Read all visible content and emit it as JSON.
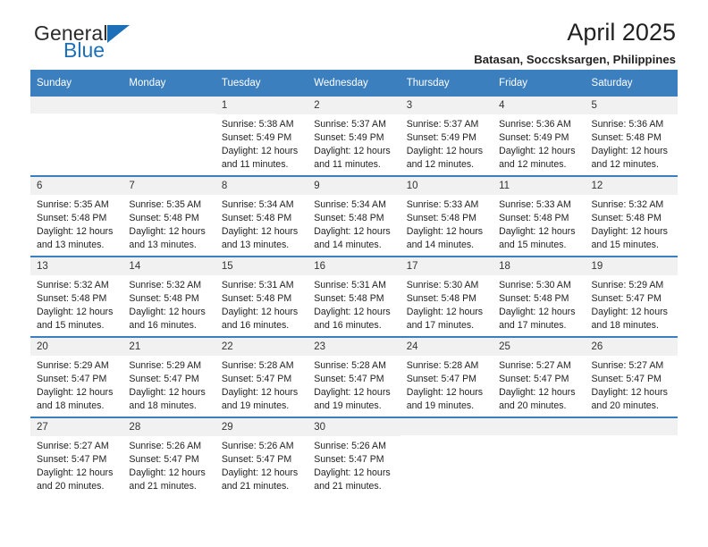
{
  "brand": {
    "name_part1": "General",
    "name_part2": "Blue",
    "accent_color": "#1d70b8"
  },
  "header": {
    "title": "April 2025",
    "subtitle": "Batasan, Soccsksargen, Philippines"
  },
  "calendar": {
    "header_bg": "#3b7fbf",
    "daynum_bg": "#f1f1f1",
    "weekday_headers": [
      "Sunday",
      "Monday",
      "Tuesday",
      "Wednesday",
      "Thursday",
      "Friday",
      "Saturday"
    ],
    "weeks": [
      [
        {
          "day": "",
          "empty": true,
          "sunrise": "",
          "sunset": "",
          "daylight1": "",
          "daylight2": ""
        },
        {
          "day": "",
          "empty": true,
          "sunrise": "",
          "sunset": "",
          "daylight1": "",
          "daylight2": ""
        },
        {
          "day": "1",
          "sunrise": "Sunrise: 5:38 AM",
          "sunset": "Sunset: 5:49 PM",
          "daylight1": "Daylight: 12 hours",
          "daylight2": "and 11 minutes."
        },
        {
          "day": "2",
          "sunrise": "Sunrise: 5:37 AM",
          "sunset": "Sunset: 5:49 PM",
          "daylight1": "Daylight: 12 hours",
          "daylight2": "and 11 minutes."
        },
        {
          "day": "3",
          "sunrise": "Sunrise: 5:37 AM",
          "sunset": "Sunset: 5:49 PM",
          "daylight1": "Daylight: 12 hours",
          "daylight2": "and 12 minutes."
        },
        {
          "day": "4",
          "sunrise": "Sunrise: 5:36 AM",
          "sunset": "Sunset: 5:49 PM",
          "daylight1": "Daylight: 12 hours",
          "daylight2": "and 12 minutes."
        },
        {
          "day": "5",
          "sunrise": "Sunrise: 5:36 AM",
          "sunset": "Sunset: 5:48 PM",
          "daylight1": "Daylight: 12 hours",
          "daylight2": "and 12 minutes."
        }
      ],
      [
        {
          "day": "6",
          "sunrise": "Sunrise: 5:35 AM",
          "sunset": "Sunset: 5:48 PM",
          "daylight1": "Daylight: 12 hours",
          "daylight2": "and 13 minutes."
        },
        {
          "day": "7",
          "sunrise": "Sunrise: 5:35 AM",
          "sunset": "Sunset: 5:48 PM",
          "daylight1": "Daylight: 12 hours",
          "daylight2": "and 13 minutes."
        },
        {
          "day": "8",
          "sunrise": "Sunrise: 5:34 AM",
          "sunset": "Sunset: 5:48 PM",
          "daylight1": "Daylight: 12 hours",
          "daylight2": "and 13 minutes."
        },
        {
          "day": "9",
          "sunrise": "Sunrise: 5:34 AM",
          "sunset": "Sunset: 5:48 PM",
          "daylight1": "Daylight: 12 hours",
          "daylight2": "and 14 minutes."
        },
        {
          "day": "10",
          "sunrise": "Sunrise: 5:33 AM",
          "sunset": "Sunset: 5:48 PM",
          "daylight1": "Daylight: 12 hours",
          "daylight2": "and 14 minutes."
        },
        {
          "day": "11",
          "sunrise": "Sunrise: 5:33 AM",
          "sunset": "Sunset: 5:48 PM",
          "daylight1": "Daylight: 12 hours",
          "daylight2": "and 15 minutes."
        },
        {
          "day": "12",
          "sunrise": "Sunrise: 5:32 AM",
          "sunset": "Sunset: 5:48 PM",
          "daylight1": "Daylight: 12 hours",
          "daylight2": "and 15 minutes."
        }
      ],
      [
        {
          "day": "13",
          "sunrise": "Sunrise: 5:32 AM",
          "sunset": "Sunset: 5:48 PM",
          "daylight1": "Daylight: 12 hours",
          "daylight2": "and 15 minutes."
        },
        {
          "day": "14",
          "sunrise": "Sunrise: 5:32 AM",
          "sunset": "Sunset: 5:48 PM",
          "daylight1": "Daylight: 12 hours",
          "daylight2": "and 16 minutes."
        },
        {
          "day": "15",
          "sunrise": "Sunrise: 5:31 AM",
          "sunset": "Sunset: 5:48 PM",
          "daylight1": "Daylight: 12 hours",
          "daylight2": "and 16 minutes."
        },
        {
          "day": "16",
          "sunrise": "Sunrise: 5:31 AM",
          "sunset": "Sunset: 5:48 PM",
          "daylight1": "Daylight: 12 hours",
          "daylight2": "and 16 minutes."
        },
        {
          "day": "17",
          "sunrise": "Sunrise: 5:30 AM",
          "sunset": "Sunset: 5:48 PM",
          "daylight1": "Daylight: 12 hours",
          "daylight2": "and 17 minutes."
        },
        {
          "day": "18",
          "sunrise": "Sunrise: 5:30 AM",
          "sunset": "Sunset: 5:48 PM",
          "daylight1": "Daylight: 12 hours",
          "daylight2": "and 17 minutes."
        },
        {
          "day": "19",
          "sunrise": "Sunrise: 5:29 AM",
          "sunset": "Sunset: 5:47 PM",
          "daylight1": "Daylight: 12 hours",
          "daylight2": "and 18 minutes."
        }
      ],
      [
        {
          "day": "20",
          "sunrise": "Sunrise: 5:29 AM",
          "sunset": "Sunset: 5:47 PM",
          "daylight1": "Daylight: 12 hours",
          "daylight2": "and 18 minutes."
        },
        {
          "day": "21",
          "sunrise": "Sunrise: 5:29 AM",
          "sunset": "Sunset: 5:47 PM",
          "daylight1": "Daylight: 12 hours",
          "daylight2": "and 18 minutes."
        },
        {
          "day": "22",
          "sunrise": "Sunrise: 5:28 AM",
          "sunset": "Sunset: 5:47 PM",
          "daylight1": "Daylight: 12 hours",
          "daylight2": "and 19 minutes."
        },
        {
          "day": "23",
          "sunrise": "Sunrise: 5:28 AM",
          "sunset": "Sunset: 5:47 PM",
          "daylight1": "Daylight: 12 hours",
          "daylight2": "and 19 minutes."
        },
        {
          "day": "24",
          "sunrise": "Sunrise: 5:28 AM",
          "sunset": "Sunset: 5:47 PM",
          "daylight1": "Daylight: 12 hours",
          "daylight2": "and 19 minutes."
        },
        {
          "day": "25",
          "sunrise": "Sunrise: 5:27 AM",
          "sunset": "Sunset: 5:47 PM",
          "daylight1": "Daylight: 12 hours",
          "daylight2": "and 20 minutes."
        },
        {
          "day": "26",
          "sunrise": "Sunrise: 5:27 AM",
          "sunset": "Sunset: 5:47 PM",
          "daylight1": "Daylight: 12 hours",
          "daylight2": "and 20 minutes."
        }
      ],
      [
        {
          "day": "27",
          "sunrise": "Sunrise: 5:27 AM",
          "sunset": "Sunset: 5:47 PM",
          "daylight1": "Daylight: 12 hours",
          "daylight2": "and 20 minutes."
        },
        {
          "day": "28",
          "sunrise": "Sunrise: 5:26 AM",
          "sunset": "Sunset: 5:47 PM",
          "daylight1": "Daylight: 12 hours",
          "daylight2": "and 21 minutes."
        },
        {
          "day": "29",
          "sunrise": "Sunrise: 5:26 AM",
          "sunset": "Sunset: 5:47 PM",
          "daylight1": "Daylight: 12 hours",
          "daylight2": "and 21 minutes."
        },
        {
          "day": "30",
          "sunrise": "Sunrise: 5:26 AM",
          "sunset": "Sunset: 5:47 PM",
          "daylight1": "Daylight: 12 hours",
          "daylight2": "and 21 minutes."
        },
        {
          "day": "",
          "empty": true,
          "sunrise": "",
          "sunset": "",
          "daylight1": "",
          "daylight2": ""
        },
        {
          "day": "",
          "empty": true,
          "sunrise": "",
          "sunset": "",
          "daylight1": "",
          "daylight2": ""
        },
        {
          "day": "",
          "empty": true,
          "sunrise": "",
          "sunset": "",
          "daylight1": "",
          "daylight2": ""
        }
      ]
    ]
  }
}
